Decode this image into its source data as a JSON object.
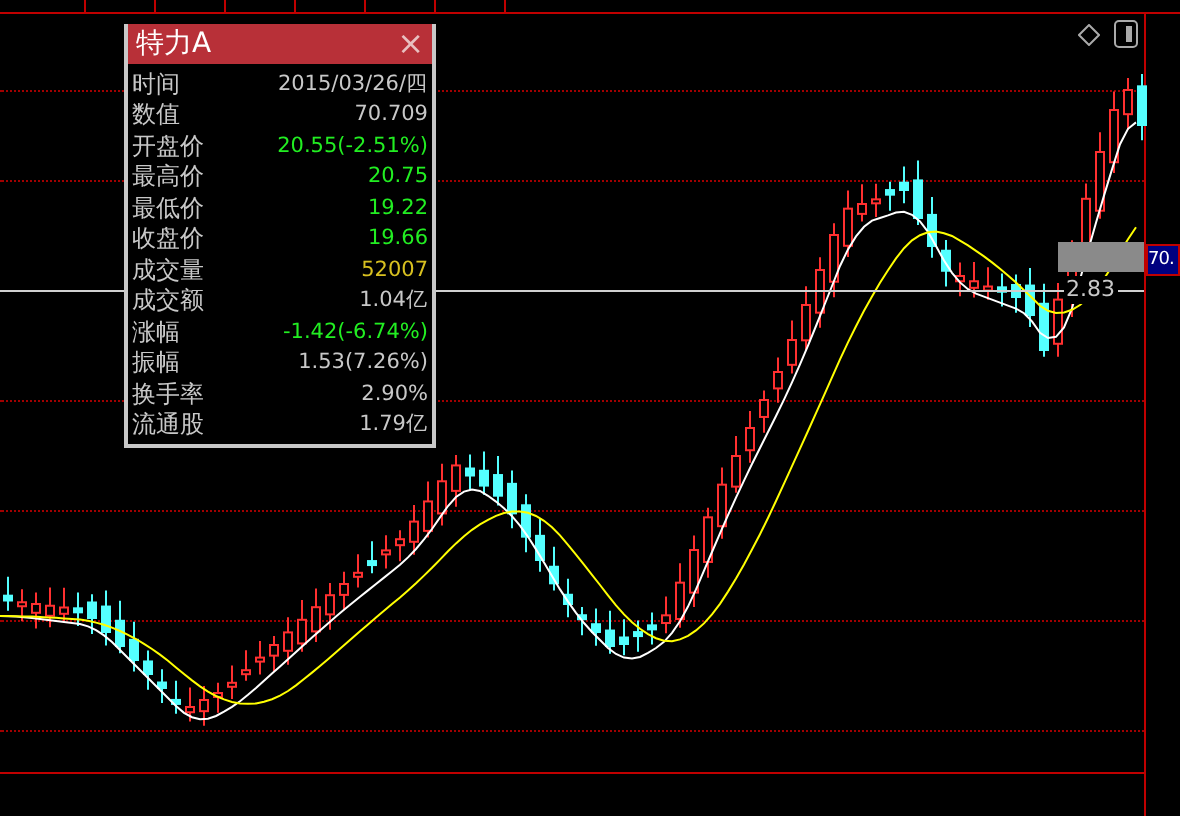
{
  "popup": {
    "title": "特力A",
    "close": "×",
    "rows": [
      {
        "label": "时间",
        "value": "2015/03/26/四",
        "color": "#c8c8c8"
      },
      {
        "label": "数值",
        "value": "70.709",
        "color": "#c8c8c8"
      },
      {
        "label": "开盘价",
        "value": "20.55(-2.51%)",
        "color": "#22ee22"
      },
      {
        "label": "最高价",
        "value": "20.75",
        "color": "#22ee22"
      },
      {
        "label": "最低价",
        "value": "19.22",
        "color": "#22ee22"
      },
      {
        "label": "收盘价",
        "value": "19.66",
        "color": "#22ee22"
      },
      {
        "label": "成交量",
        "value": "52007",
        "color": "#d8c020"
      },
      {
        "label": "成交额",
        "value": "1.04亿",
        "color": "#c8c8c8"
      },
      {
        "label": "涨幅",
        "value": "-1.42(-6.74%)",
        "color": "#22ee22"
      },
      {
        "label": "振幅",
        "value": "1.53(7.26%)",
        "color": "#c8c8c8"
      },
      {
        "label": "换手率",
        "value": "2.90%",
        "color": "#c8c8c8"
      },
      {
        "label": "流通股",
        "value": "1.79亿",
        "color": "#c8c8c8"
      }
    ]
  },
  "price_tag": "70.",
  "crosshair_label": "2.83"
}
